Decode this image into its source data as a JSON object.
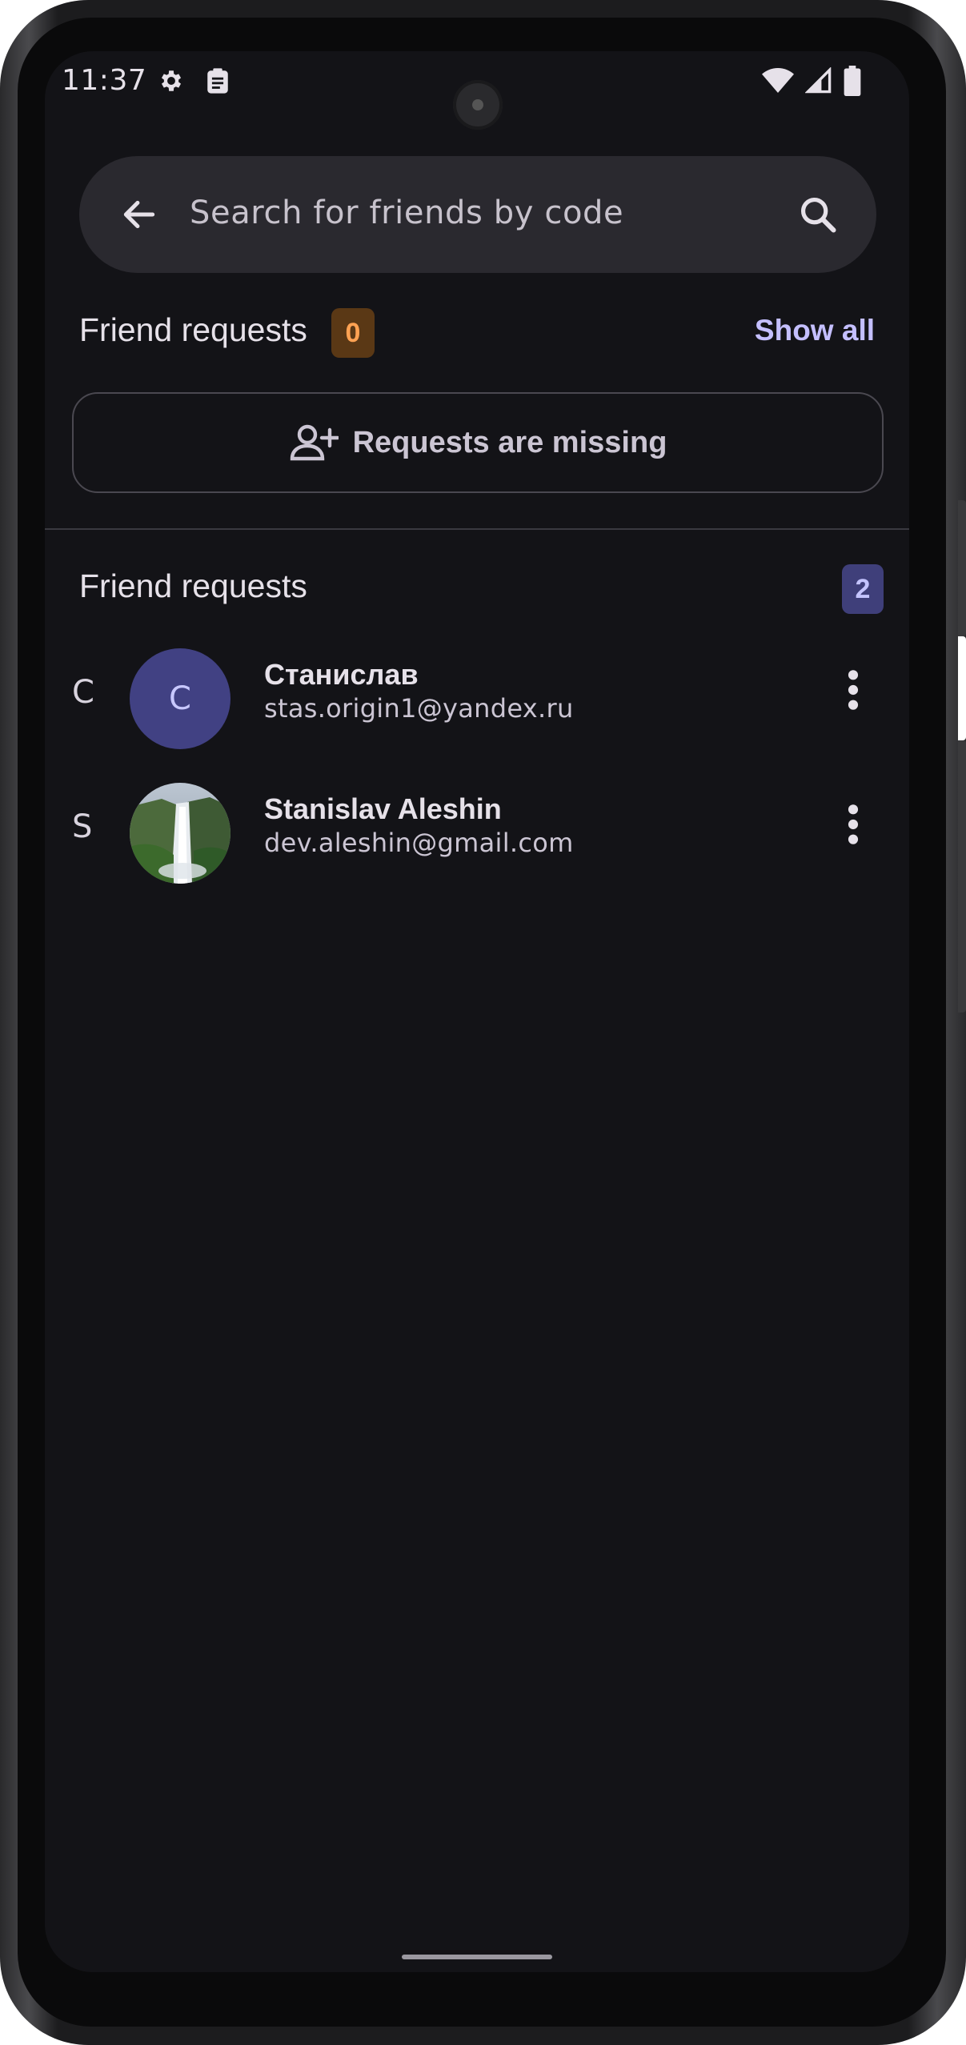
{
  "status_bar": {
    "time": "11:37",
    "icons": [
      "gear-icon",
      "clipboard-icon",
      "wifi-icon",
      "signal-icon",
      "battery-icon"
    ]
  },
  "search": {
    "placeholder": "Search for friends by code",
    "back_icon": "arrow-left-icon",
    "search_icon": "magnifier-icon"
  },
  "requests_section": {
    "title": "Friend requests",
    "count": "0",
    "show_all": "Show all",
    "empty_button_label": "Requests are missing",
    "empty_button_icon": "person-add-icon"
  },
  "friends_section": {
    "title": "Friend requests",
    "count": "2",
    "items": [
      {
        "letter": "С",
        "avatar_initial": "С",
        "name": "Станислав",
        "email": "stas.origin1@yandex.ru"
      },
      {
        "letter": "S",
        "avatar_initial": "",
        "name": "Stanislav Aleshin",
        "email": "dev.aleshin@gmail.com"
      }
    ]
  },
  "colors": {
    "background": "#131317",
    "search_bar": "#2a292f",
    "accent_link": "#c4bfff",
    "requests_badge_bg": "#5a3815",
    "requests_badge_fg": "#ffa253",
    "friends_badge_bg": "#3f3f7a",
    "avatar_bg": "#414183"
  }
}
